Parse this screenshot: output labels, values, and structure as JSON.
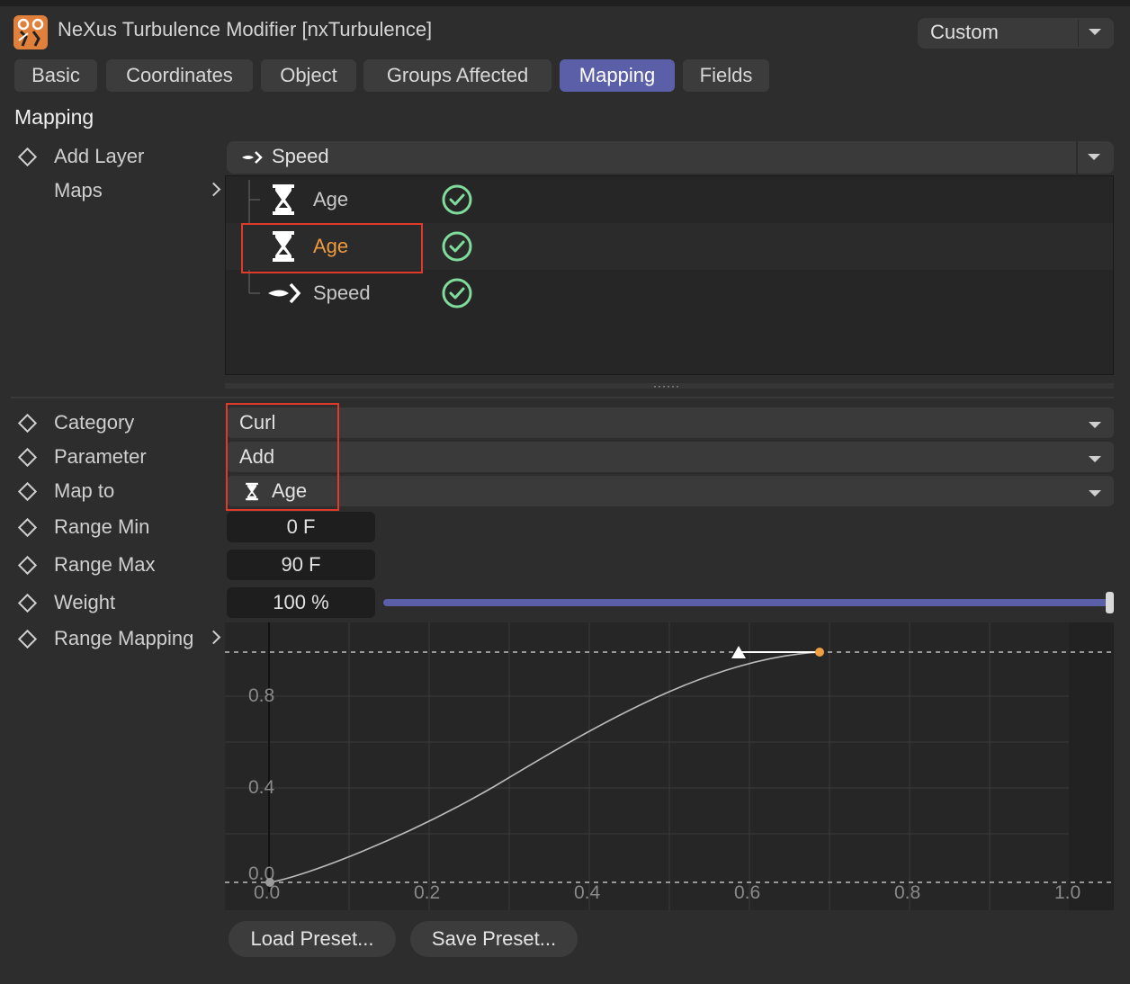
{
  "header": {
    "title": "NeXus Turbulence Modifier [nxTurbulence]",
    "preset": "Custom"
  },
  "tabs": [
    "Basic",
    "Coordinates",
    "Object",
    "Groups Affected",
    "Mapping",
    "Fields"
  ],
  "active_tab": "Mapping",
  "section_title": "Mapping",
  "labels": {
    "add_layer": "Add Layer",
    "maps": "Maps",
    "category": "Category",
    "parameter": "Parameter",
    "map_to": "Map to",
    "range_min": "Range Min",
    "range_max": "Range Max",
    "weight": "Weight",
    "range_mapping": "Range Mapping"
  },
  "add_layer_value": "Speed",
  "maps": [
    {
      "icon": "hourglass-icon",
      "label": "Age",
      "enabled": true,
      "selected": false
    },
    {
      "icon": "hourglass-icon",
      "label": "Age",
      "enabled": true,
      "selected": true
    },
    {
      "icon": "speed-icon",
      "label": "Speed",
      "enabled": true,
      "selected": false
    }
  ],
  "fields": {
    "category": "Curl",
    "parameter": "Add",
    "map_to": "Age",
    "range_min": "0 F",
    "range_max": "90 F",
    "weight": "100 %",
    "weight_fraction": 1.0
  },
  "graph": {
    "y_ticks": [
      "0.8",
      "0.4",
      "0.0"
    ],
    "x_ticks": [
      "0.0",
      "0.2",
      "0.4",
      "0.6",
      "0.8",
      "1.0"
    ]
  },
  "buttons": {
    "load": "Load Preset...",
    "save": "Save Preset..."
  },
  "colors": {
    "accent": "#5b5fa8",
    "selected_text": "#ef9a3e",
    "check": "#7fdc9a",
    "highlight_box": "#e03a2a"
  }
}
